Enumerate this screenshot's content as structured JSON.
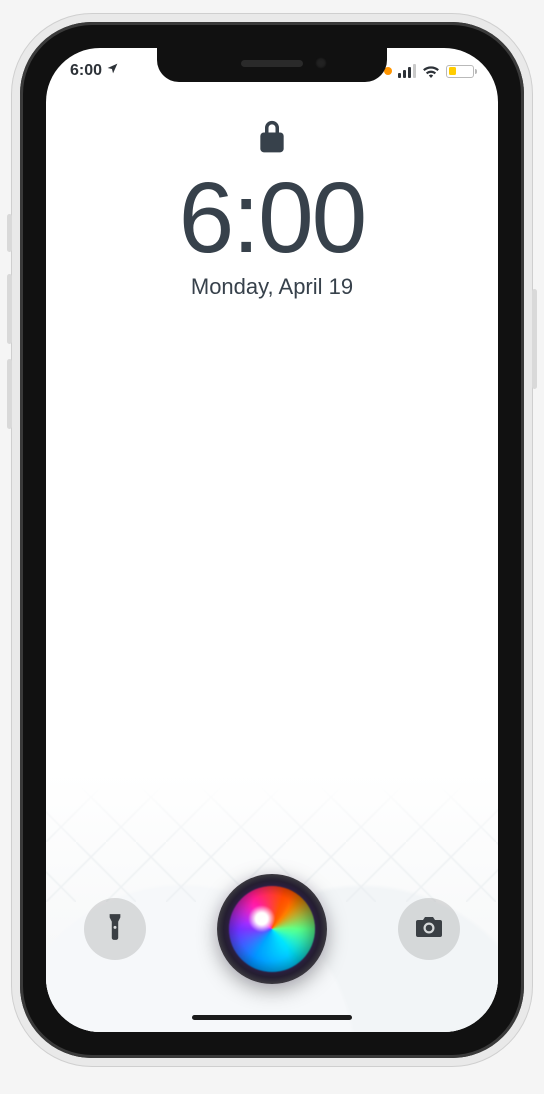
{
  "status": {
    "time": "6:00",
    "location_services": true,
    "privacy_dot": "orange",
    "signal_bars": 3,
    "wifi": true,
    "battery_low_power": true
  },
  "lock": {
    "locked": true,
    "time": "6:00",
    "date": "Monday, April 19"
  },
  "controls": {
    "flashlight_label": "Flashlight",
    "camera_label": "Camera",
    "siri_label": "Siri"
  }
}
